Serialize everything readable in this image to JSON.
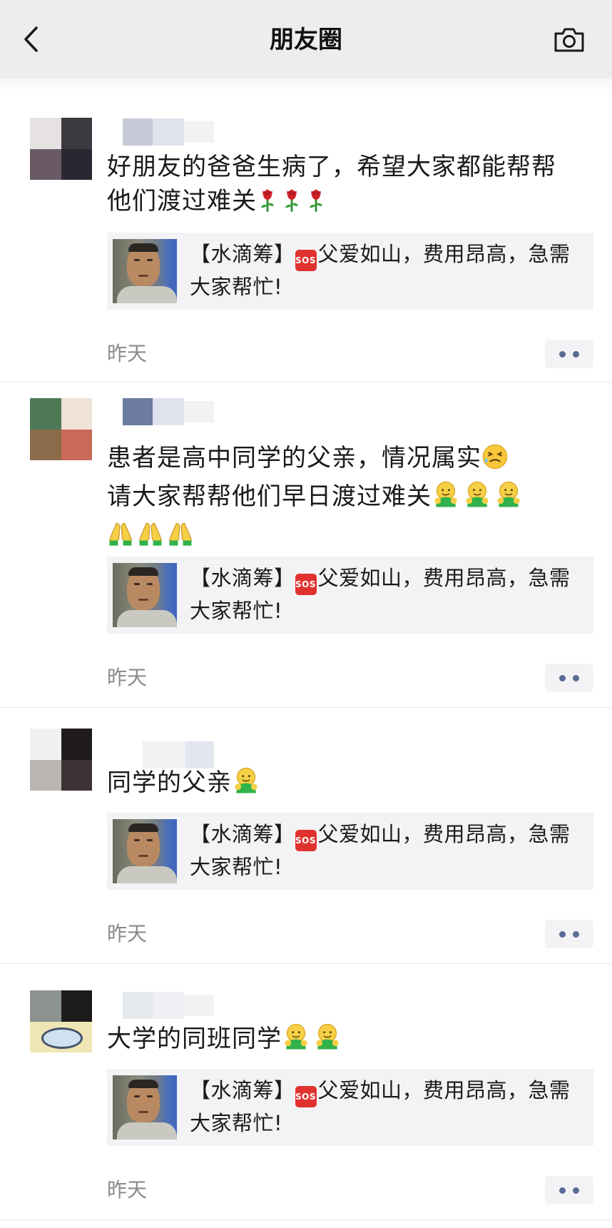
{
  "header": {
    "title": "朋友圈",
    "back_icon": "chevron-left-icon",
    "camera_icon": "camera-icon"
  },
  "card": {
    "prefix": "【水滴筹】",
    "sos_label": "SOS",
    "line1": "父爱如山，费用昂高，急需",
    "line2": "大家帮忙!"
  },
  "posts": [
    {
      "text_lines": [
        "好朋友的爸爸生病了，希望大家都能帮帮",
        "他们渡过难关"
      ],
      "emoji_after": "rose-icon ×3",
      "time": "昨天"
    },
    {
      "text_lines": [
        "患者是高中同学的父亲，情况属实",
        "请大家帮帮他们早日渡过难关"
      ],
      "emoji_after": "persevere-face-icon; hug-icon ×3; pray-icon ×3",
      "time": "昨天"
    },
    {
      "text_lines": [
        "同学的父亲"
      ],
      "emoji_after": "hug-icon",
      "time": "昨天"
    },
    {
      "text_lines": [
        "大学的同班同学"
      ],
      "emoji_after": "hug-icon ×2",
      "time": "昨天"
    }
  ],
  "colors": {
    "link_blue": "#576b95",
    "header_bg": "#ededed",
    "card_bg": "#f3f3f5",
    "time_gray": "#8a8a8a"
  }
}
